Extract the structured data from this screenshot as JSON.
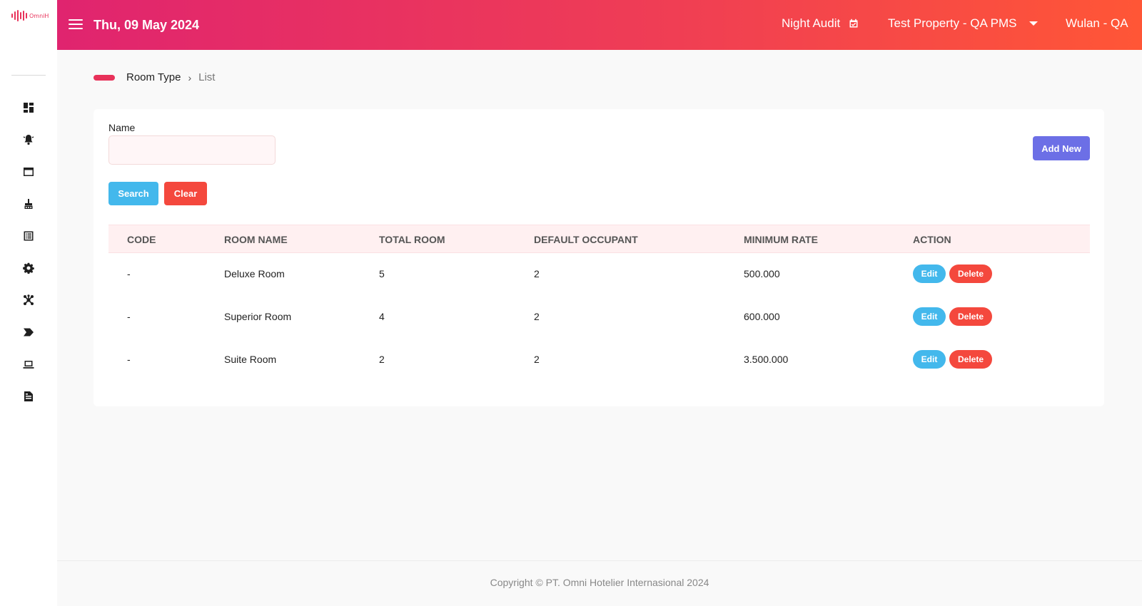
{
  "brand": {
    "logo_text": "OmniH"
  },
  "header": {
    "date": "Thu, 09 May 2024",
    "night_audit": "Night Audit",
    "property": "Test Property - QA PMS",
    "user": "Wulan - QA"
  },
  "sidebar": {
    "icons": [
      "dashboard-icon",
      "bell-icon",
      "window-icon",
      "broom-icon",
      "list-icon",
      "gear-icon",
      "network-icon",
      "chevron-tag-icon",
      "laptop-icon",
      "document-icon"
    ]
  },
  "breadcrumb": {
    "section": "Room Type",
    "separator": "›",
    "page": "List"
  },
  "filters": {
    "name_label": "Name",
    "name_value": "",
    "search_label": "Search",
    "clear_label": "Clear",
    "add_label": "Add New"
  },
  "table": {
    "columns": [
      "CODE",
      "ROOM NAME",
      "TOTAL ROOM",
      "DEFAULT OCCUPANT",
      "MINIMUM RATE",
      "ACTION"
    ],
    "rows": [
      {
        "code": "-",
        "name": "Deluxe Room",
        "total": "5",
        "occupant": "2",
        "rate": "500.000"
      },
      {
        "code": "-",
        "name": "Superior Room",
        "total": "4",
        "occupant": "2",
        "rate": "600.000"
      },
      {
        "code": "-",
        "name": "Suite Room",
        "total": "2",
        "occupant": "2",
        "rate": "3.500.000"
      }
    ],
    "edit_label": "Edit",
    "delete_label": "Delete"
  },
  "footer": {
    "copyright": "Copyright © PT. Omni Hotelier Internasional 2024"
  },
  "colors": {
    "header_gradient_start": "#e0246f",
    "header_gradient_end": "#ff5636",
    "primary_blue": "#43b8ec",
    "danger_red": "#f4483d",
    "add_purple": "#6c6fe6"
  }
}
